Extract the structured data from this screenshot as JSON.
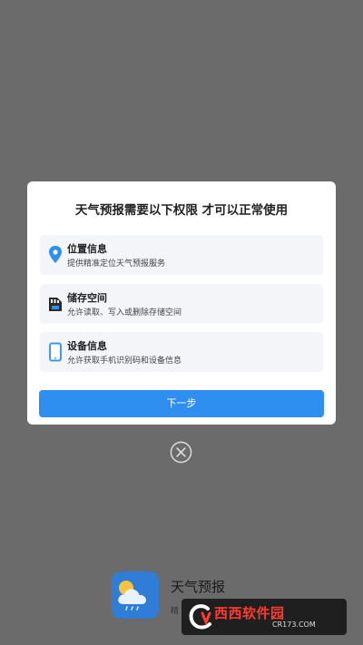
{
  "dialog": {
    "title": "天气预报需要以下权限 才可以正常使用",
    "permissions": [
      {
        "icon": "location-pin-icon",
        "title": "位置信息",
        "desc": "提供精准定位天气预报服务"
      },
      {
        "icon": "sd-card-icon",
        "title": "储存空间",
        "desc": "允许读取、写入或删除存储空间"
      },
      {
        "icon": "phone-icon",
        "title": "设备信息",
        "desc": "允许获取手机识别码和设备信息"
      }
    ],
    "next_label": "下一步"
  },
  "close": {
    "icon": "close-circle-icon"
  },
  "app": {
    "name": "天气预报",
    "subtitle": "精"
  },
  "watermark": {
    "cn_text": "西西软件园",
    "en_text": "CR173.COM"
  },
  "colors": {
    "accent": "#2f8ff0",
    "overlay": "#6b6b6b",
    "card_bg": "#f3f5f9"
  }
}
